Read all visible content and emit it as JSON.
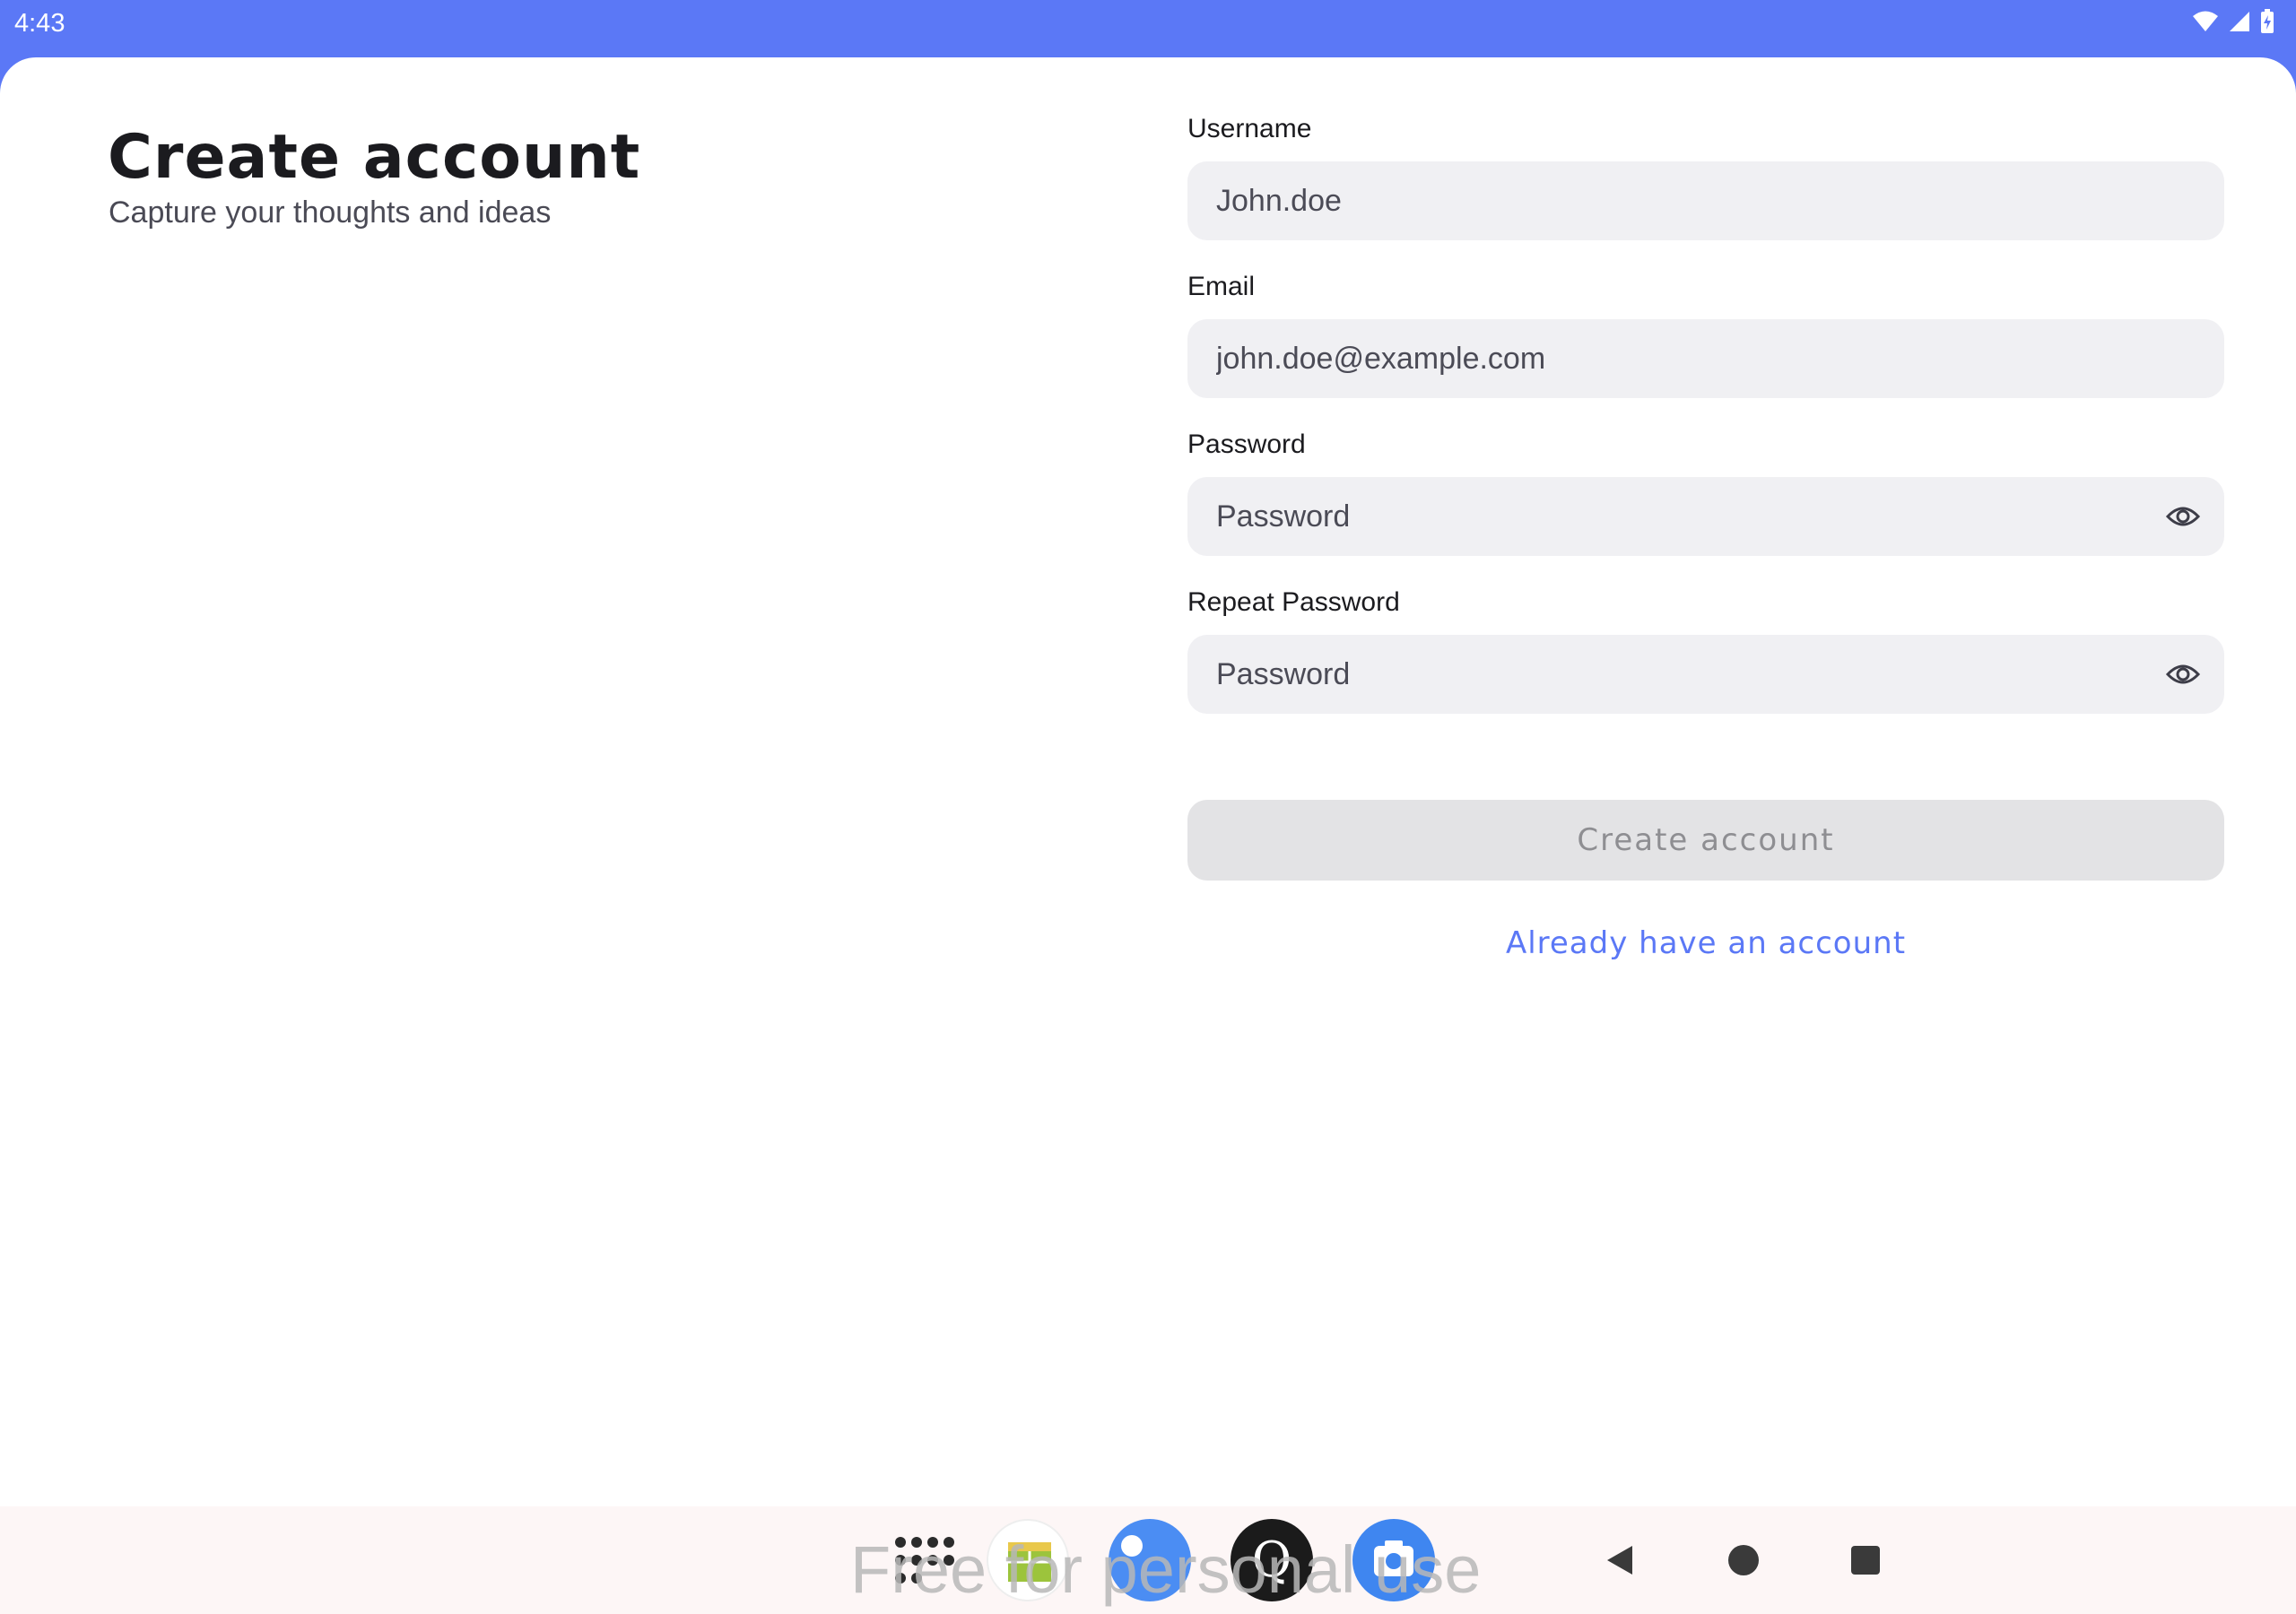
{
  "status_bar": {
    "time": "4:43",
    "icons": [
      "wifi-icon",
      "signal-icon",
      "battery-charging-icon"
    ]
  },
  "header": {
    "title": "Create account",
    "subtitle": "Capture your thoughts and ideas"
  },
  "form": {
    "username": {
      "label": "Username",
      "placeholder": "John.doe"
    },
    "email": {
      "label": "Email",
      "placeholder": "john.doe@example.com"
    },
    "password": {
      "label": "Password",
      "placeholder": "Password"
    },
    "repeat_password": {
      "label": "Repeat Password",
      "placeholder": "Password"
    },
    "submit_label": "Create account",
    "login_link": "Already have an account"
  },
  "nav_bar": {
    "dock_apps": [
      "app-drawer-icon",
      "sheets-app-icon",
      "files-app-icon",
      "q-app-icon",
      "camera-app-icon"
    ],
    "q_letter": "Q",
    "watermark": "Free for personal use",
    "buttons": [
      "back-icon",
      "home-icon",
      "recents-icon"
    ]
  },
  "colors": {
    "accent": "#5B78F6",
    "field_bg": "#F0F0F3",
    "button_disabled_bg": "#E3E3E5",
    "button_disabled_text": "#8E8E92"
  }
}
